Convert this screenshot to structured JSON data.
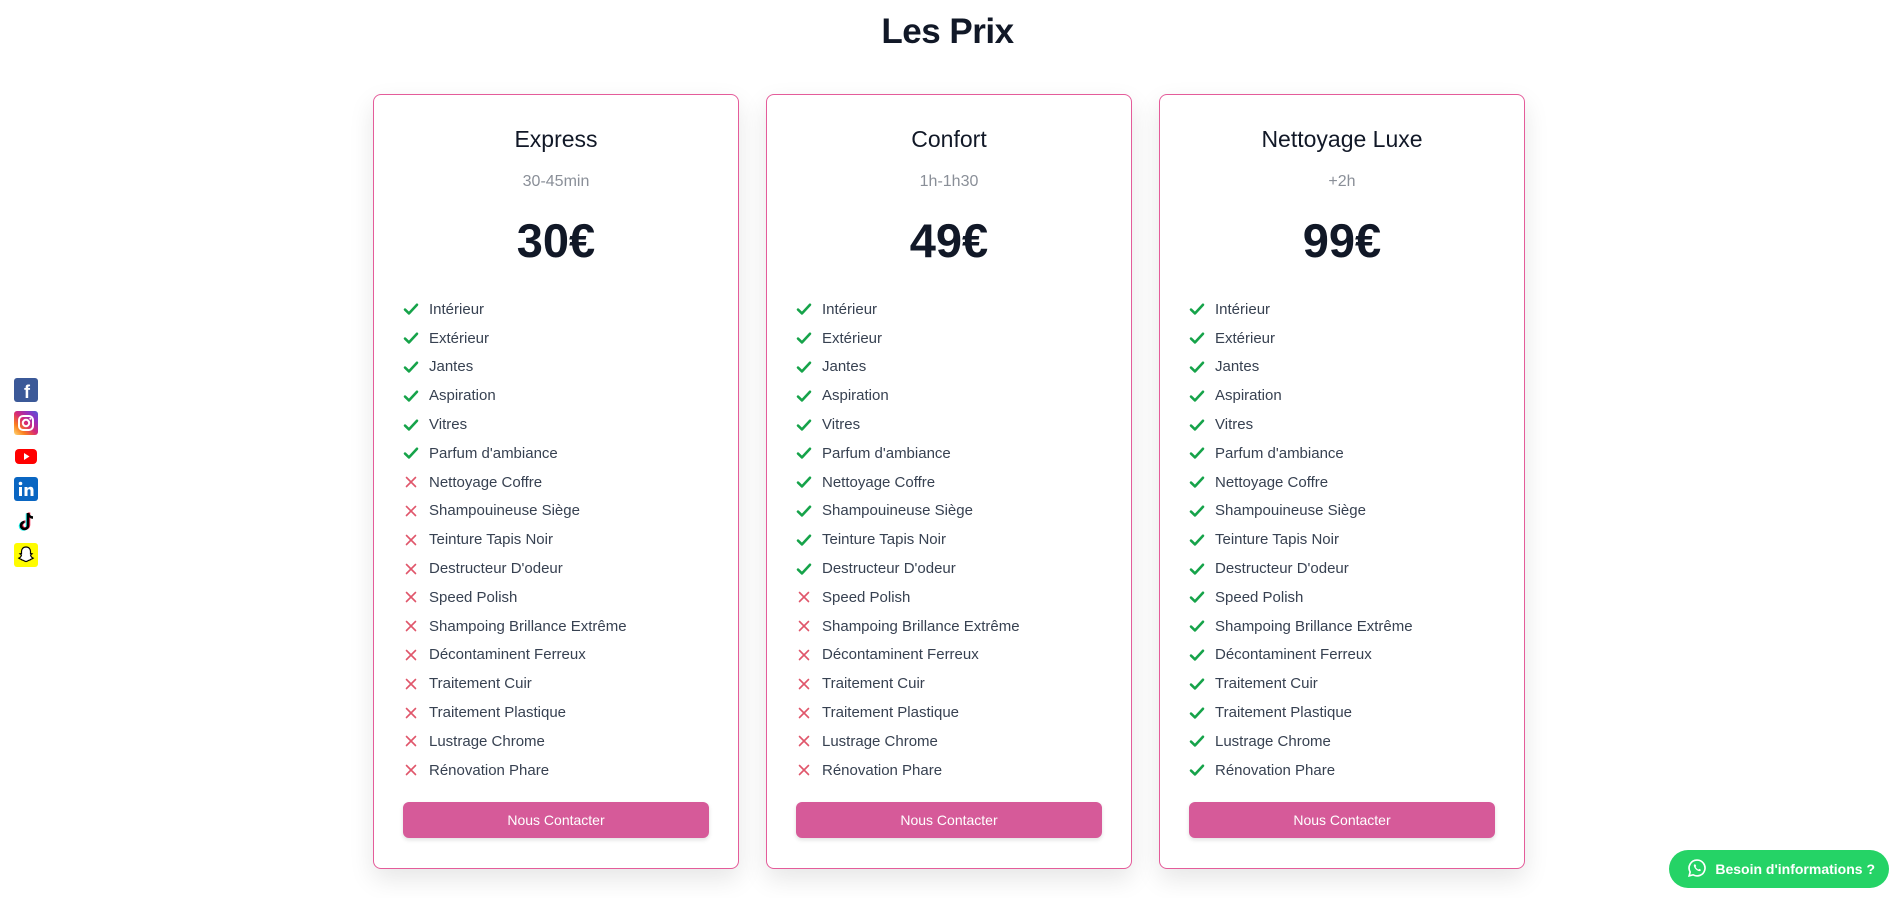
{
  "section_title": "Les Prix",
  "plans": [
    {
      "name": "Express",
      "duration": "30-45min",
      "price": "30€",
      "cta": "Nous Contacter",
      "features": [
        {
          "label": "Intérieur",
          "included": true
        },
        {
          "label": "Extérieur",
          "included": true
        },
        {
          "label": "Jantes",
          "included": true
        },
        {
          "label": "Aspiration",
          "included": true
        },
        {
          "label": "Vitres",
          "included": true
        },
        {
          "label": "Parfum d'ambiance",
          "included": true
        },
        {
          "label": "Nettoyage Coffre",
          "included": false
        },
        {
          "label": "Shampouineuse Siège",
          "included": false
        },
        {
          "label": "Teinture Tapis Noir",
          "included": false
        },
        {
          "label": "Destructeur D'odeur",
          "included": false
        },
        {
          "label": "Speed Polish",
          "included": false
        },
        {
          "label": "Shampoing Brillance Extrême",
          "included": false
        },
        {
          "label": "Décontaminent Ferreux",
          "included": false
        },
        {
          "label": "Traitement Cuir",
          "included": false
        },
        {
          "label": "Traitement Plastique",
          "included": false
        },
        {
          "label": "Lustrage Chrome",
          "included": false
        },
        {
          "label": "Rénovation Phare",
          "included": false
        }
      ]
    },
    {
      "name": "Confort",
      "duration": "1h-1h30",
      "price": "49€",
      "cta": "Nous Contacter",
      "features": [
        {
          "label": "Intérieur",
          "included": true
        },
        {
          "label": "Extérieur",
          "included": true
        },
        {
          "label": "Jantes",
          "included": true
        },
        {
          "label": "Aspiration",
          "included": true
        },
        {
          "label": "Vitres",
          "included": true
        },
        {
          "label": "Parfum d'ambiance",
          "included": true
        },
        {
          "label": "Nettoyage Coffre",
          "included": true
        },
        {
          "label": "Shampouineuse Siège",
          "included": true
        },
        {
          "label": "Teinture Tapis Noir",
          "included": true
        },
        {
          "label": "Destructeur D'odeur",
          "included": true
        },
        {
          "label": "Speed Polish",
          "included": false
        },
        {
          "label": "Shampoing Brillance Extrême",
          "included": false
        },
        {
          "label": "Décontaminent Ferreux",
          "included": false
        },
        {
          "label": "Traitement Cuir",
          "included": false
        },
        {
          "label": "Traitement Plastique",
          "included": false
        },
        {
          "label": "Lustrage Chrome",
          "included": false
        },
        {
          "label": "Rénovation Phare",
          "included": false
        }
      ]
    },
    {
      "name": "Nettoyage Luxe",
      "duration": "+2h",
      "price": "99€",
      "cta": "Nous Contacter",
      "features": [
        {
          "label": "Intérieur",
          "included": true
        },
        {
          "label": "Extérieur",
          "included": true
        },
        {
          "label": "Jantes",
          "included": true
        },
        {
          "label": "Aspiration",
          "included": true
        },
        {
          "label": "Vitres",
          "included": true
        },
        {
          "label": "Parfum d'ambiance",
          "included": true
        },
        {
          "label": "Nettoyage Coffre",
          "included": true
        },
        {
          "label": "Shampouineuse Siège",
          "included": true
        },
        {
          "label": "Teinture Tapis Noir",
          "included": true
        },
        {
          "label": "Destructeur D'odeur",
          "included": true
        },
        {
          "label": "Speed Polish",
          "included": true
        },
        {
          "label": "Shampoing Brillance Extrême",
          "included": true
        },
        {
          "label": "Décontaminent Ferreux",
          "included": true
        },
        {
          "label": "Traitement Cuir",
          "included": true
        },
        {
          "label": "Traitement Plastique",
          "included": true
        },
        {
          "label": "Lustrage Chrome",
          "included": true
        },
        {
          "label": "Rénovation Phare",
          "included": true
        }
      ]
    }
  ],
  "social": [
    {
      "icon": "facebook-icon",
      "color": "#3b5998"
    },
    {
      "icon": "instagram-icon",
      "color": "#d62976"
    },
    {
      "icon": "youtube-icon",
      "color": "#ff0000"
    },
    {
      "icon": "linkedin-icon",
      "color": "#0a66c2"
    },
    {
      "icon": "tiktok-icon",
      "color": "#000000"
    },
    {
      "icon": "snapchat-icon",
      "color": "#fffc00"
    }
  ],
  "whatsapp": {
    "label": "Besoin d'informations ?",
    "color": "#25d366"
  },
  "colors": {
    "accent": "#d65a99",
    "border": "#e45c9a",
    "check": "#16a34a",
    "cross": "#e0566b"
  }
}
